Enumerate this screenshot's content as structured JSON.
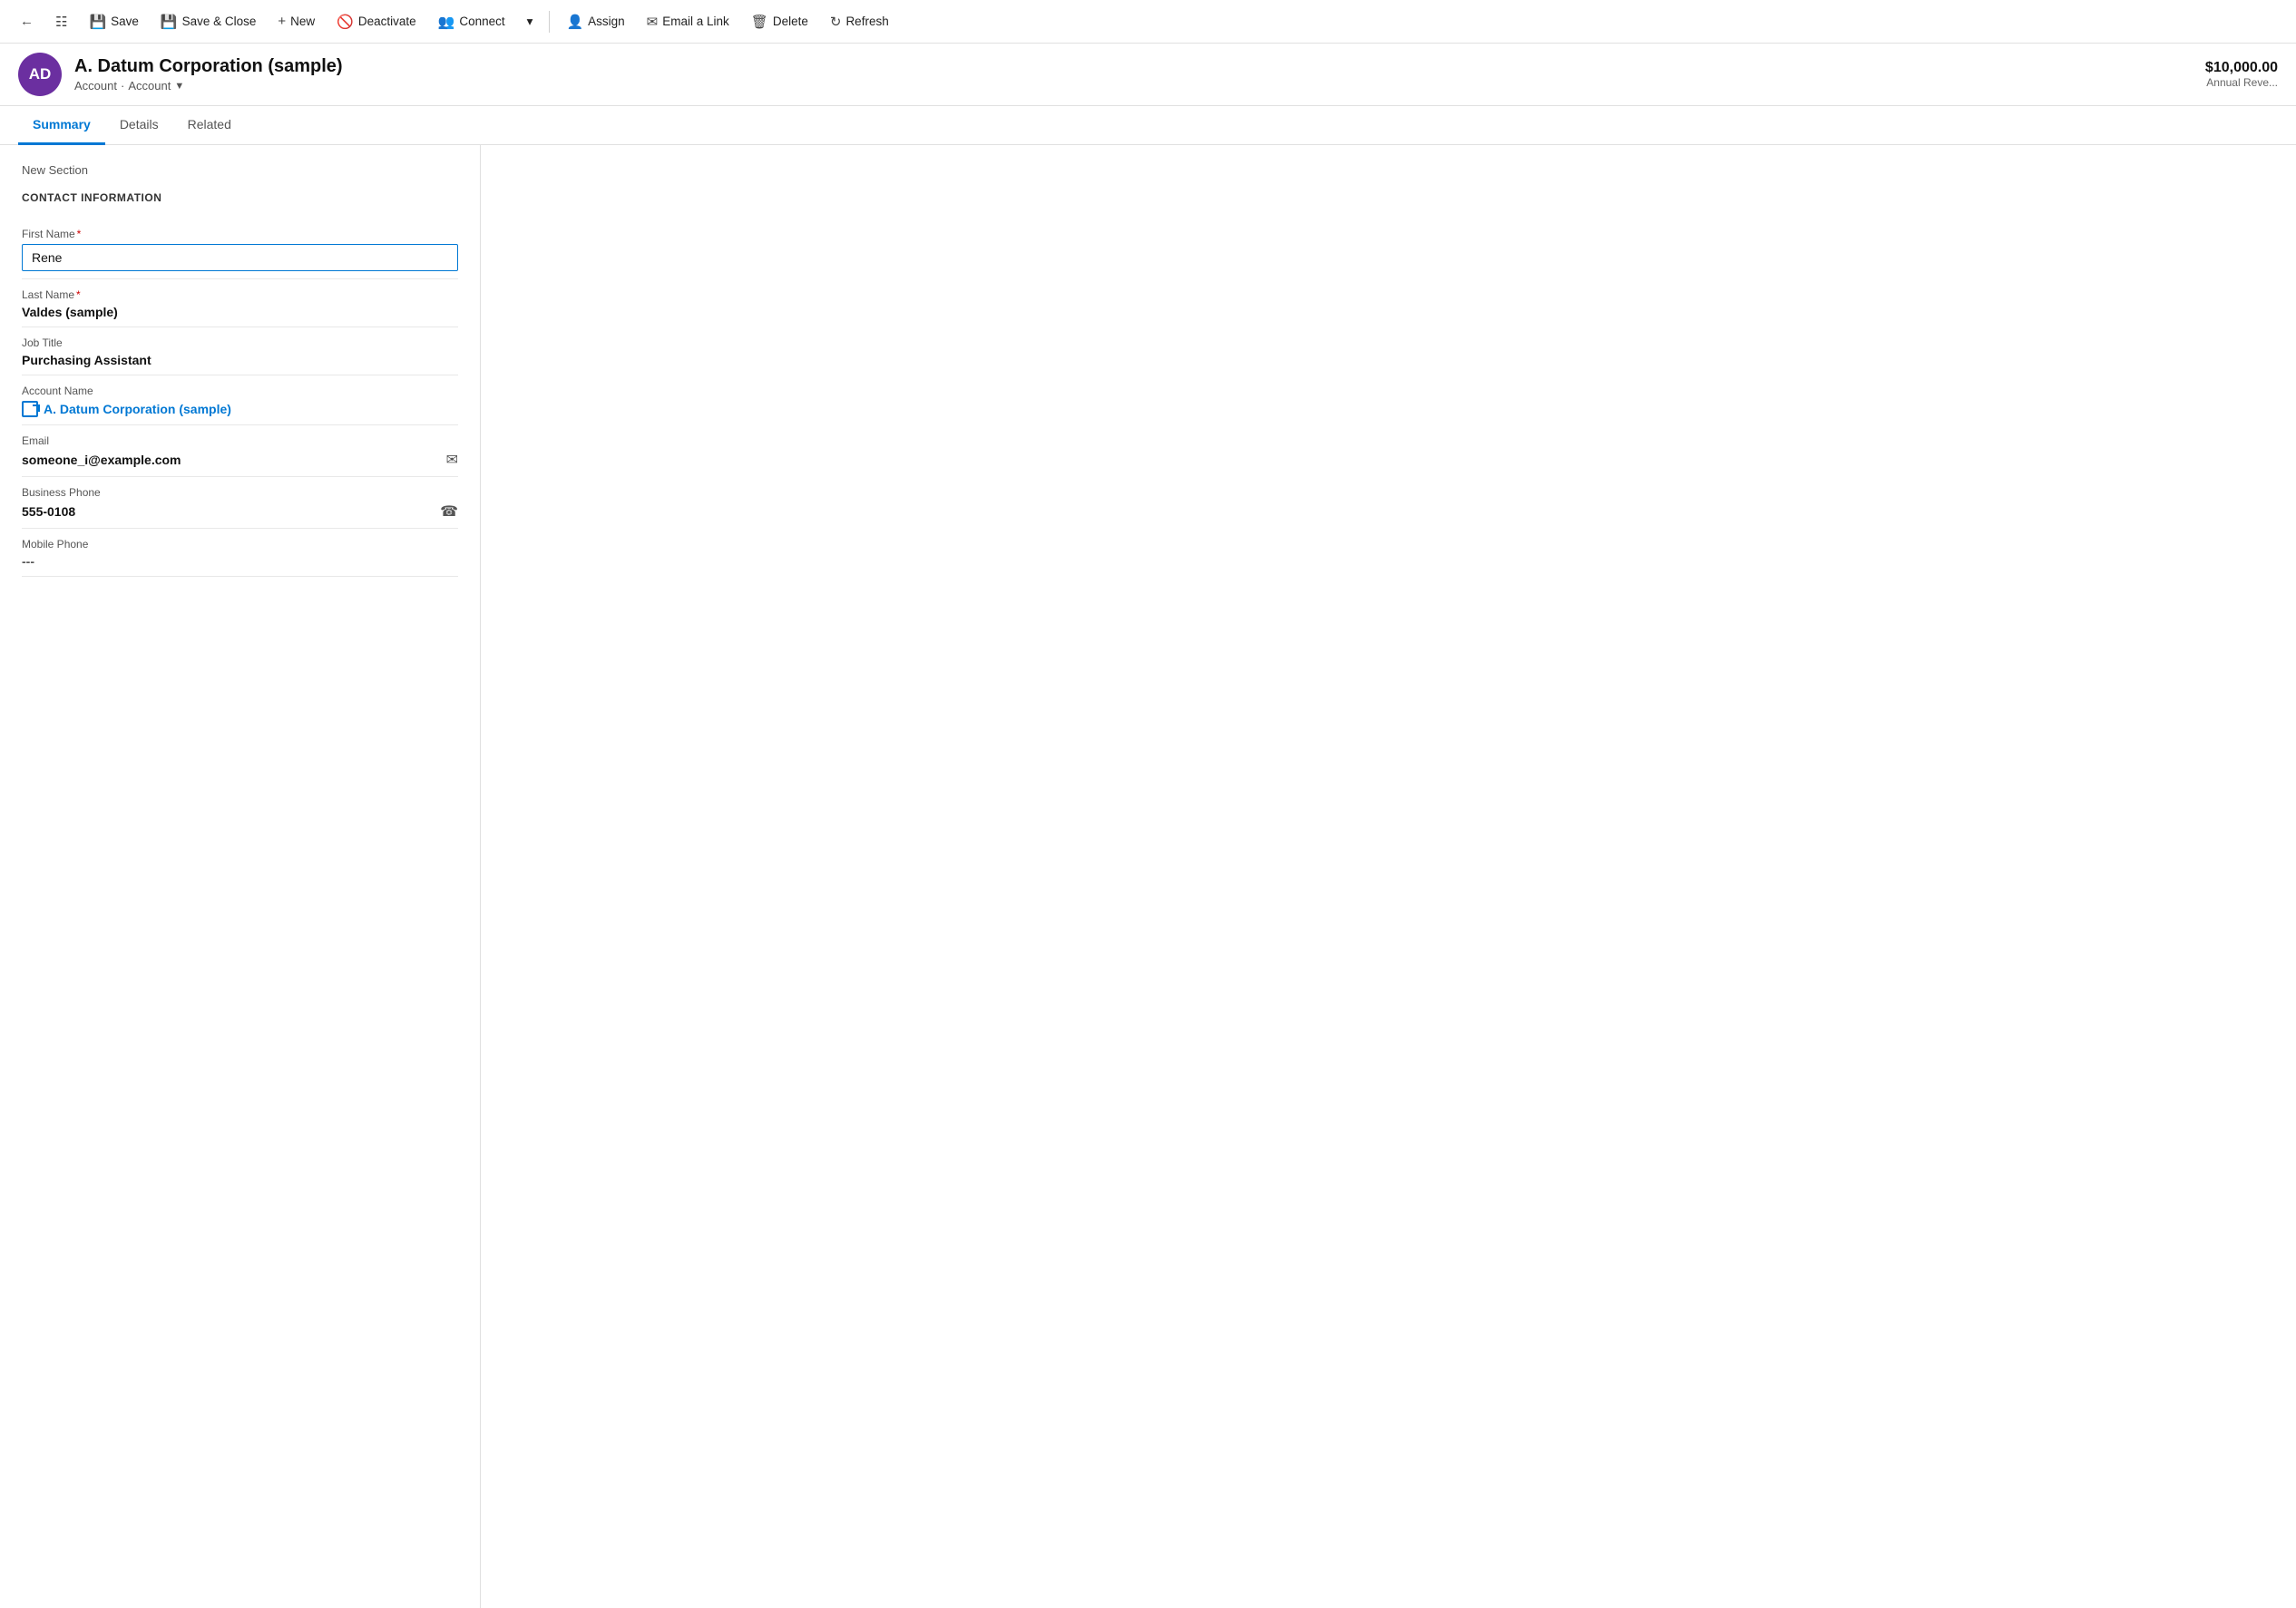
{
  "toolbar": {
    "back_label": "←",
    "record_icon": "▦",
    "save_label": "Save",
    "save_close_label": "Save & Close",
    "new_label": "New",
    "deactivate_label": "Deactivate",
    "connect_label": "Connect",
    "more_label": "▾",
    "assign_label": "Assign",
    "email_link_label": "Email a Link",
    "delete_label": "Delete",
    "refresh_label": "Refresh"
  },
  "entity": {
    "avatar_initials": "AD",
    "avatar_bg": "#6b2fa0",
    "title": "A. Datum Corporation (sample)",
    "breadcrumb1": "Account",
    "breadcrumb2": "Account",
    "revenue_value": "$10,000.00",
    "revenue_label": "Annual Reve..."
  },
  "tabs": [
    {
      "id": "summary",
      "label": "Summary",
      "active": true
    },
    {
      "id": "details",
      "label": "Details",
      "active": false
    },
    {
      "id": "related",
      "label": "Related",
      "active": false
    }
  ],
  "form": {
    "new_section_label": "New Section",
    "contact_section_title": "CONTACT INFORMATION",
    "fields": [
      {
        "id": "first_name",
        "label": "First Name",
        "required": true,
        "type": "input",
        "value": "Rene"
      },
      {
        "id": "last_name",
        "label": "Last Name",
        "required": true,
        "type": "text",
        "value": "Valdes (sample)"
      },
      {
        "id": "job_title",
        "label": "Job Title",
        "required": false,
        "type": "text",
        "value": "Purchasing Assistant"
      },
      {
        "id": "account_name",
        "label": "Account Name",
        "required": false,
        "type": "link",
        "value": "A. Datum Corporation (sample)"
      },
      {
        "id": "email",
        "label": "Email",
        "required": false,
        "type": "text_icon",
        "value": "someone_i@example.com",
        "icon": "email"
      },
      {
        "id": "business_phone",
        "label": "Business Phone",
        "required": false,
        "type": "text_icon",
        "value": "555-0108",
        "icon": "phone"
      },
      {
        "id": "mobile_phone",
        "label": "Mobile Phone",
        "required": false,
        "type": "text",
        "value": "---"
      }
    ]
  }
}
